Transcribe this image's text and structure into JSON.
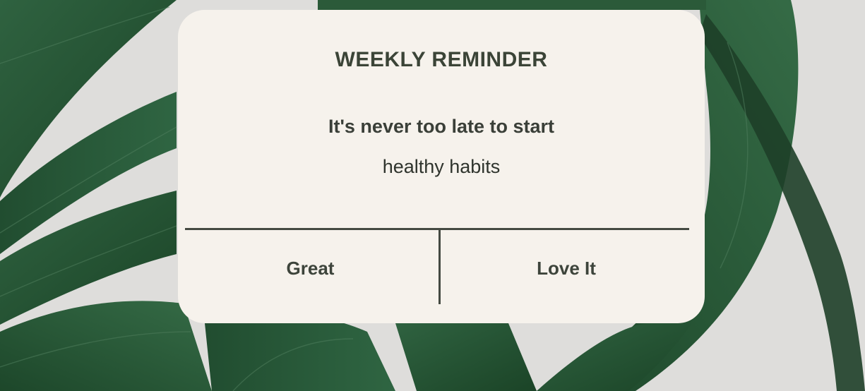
{
  "dialog": {
    "title": "WEEKLY REMINDER",
    "message_line1": "It's never too late to start",
    "message_line2": "healthy habits",
    "buttons": [
      {
        "label": "Great"
      },
      {
        "label": "Love It"
      }
    ]
  },
  "colors": {
    "dialog_background": "#f6f2ec",
    "text_primary": "#3b4437",
    "divider": "#444a42",
    "leaf_dark": "#1f4a2c",
    "leaf_mid": "#2e5e3a",
    "backdrop": "#d9d8d6"
  }
}
